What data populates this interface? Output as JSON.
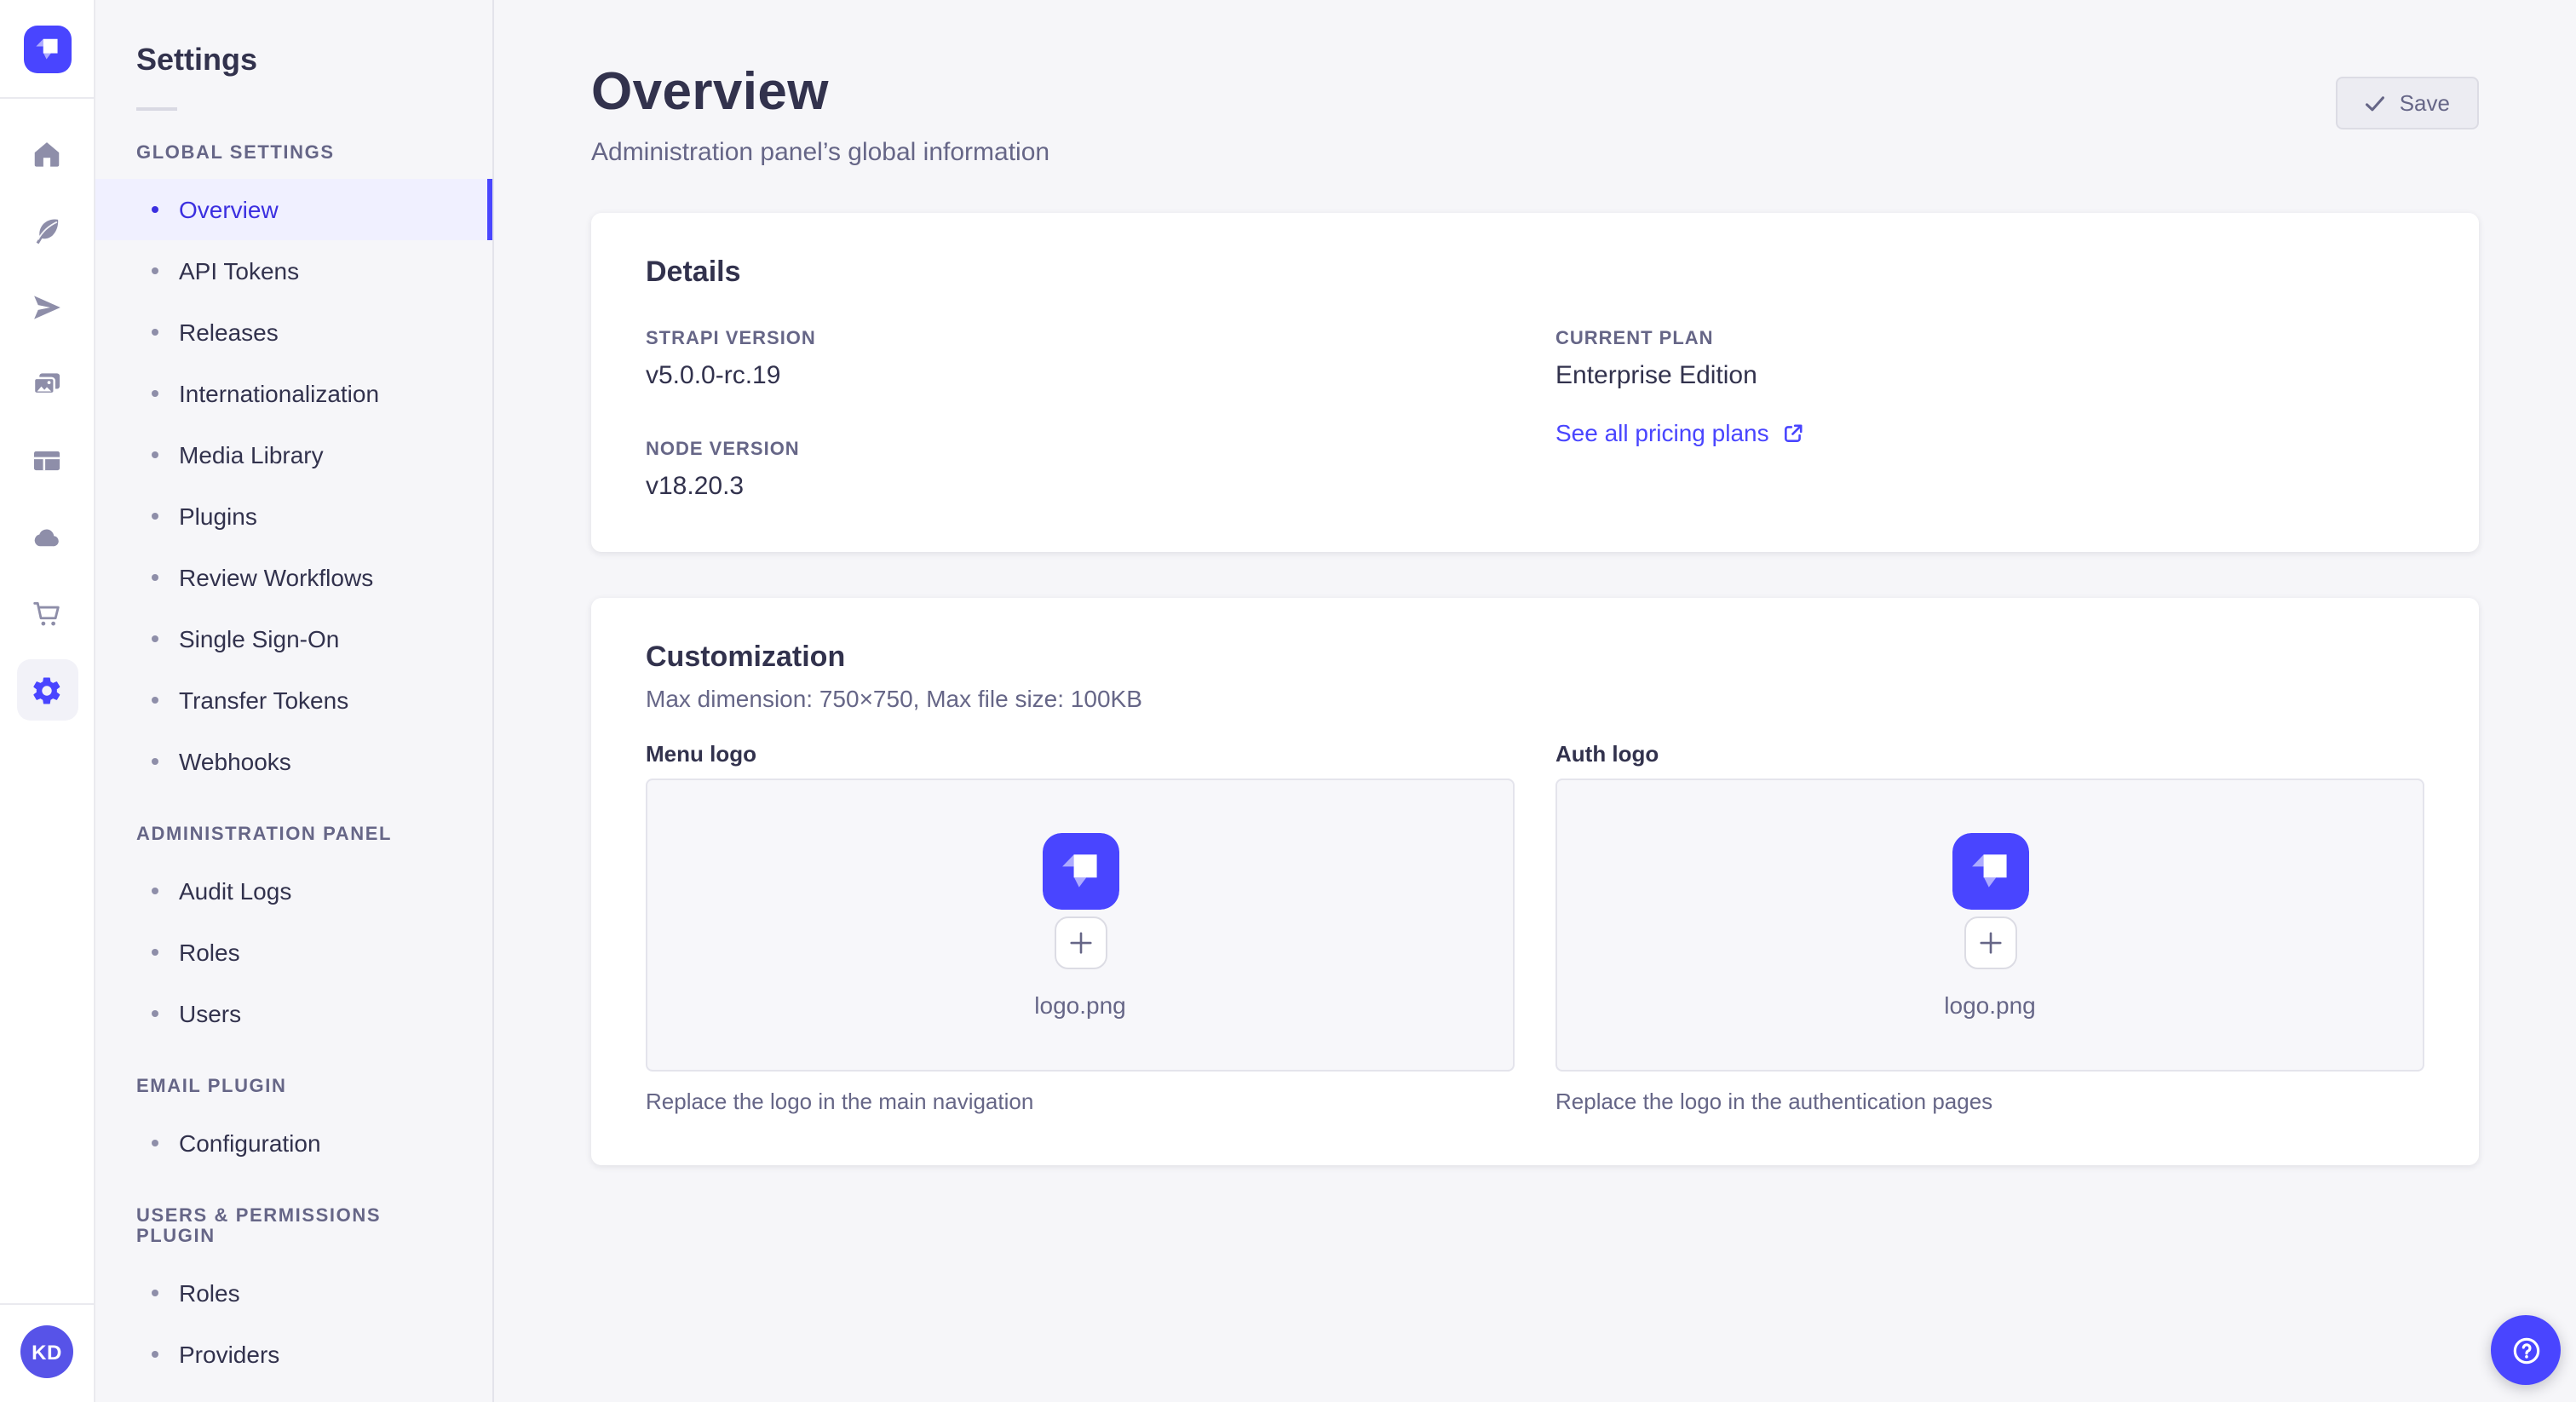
{
  "colors": {
    "accent": "#4945ff",
    "active_text": "#3b2fe0",
    "active_bg": "#f0f0ff",
    "text_dark": "#32324d",
    "text_muted": "#666687",
    "page_bg": "#f6f6f9"
  },
  "icon_rail": {
    "logo": "strapi-logo",
    "items": [
      {
        "icon": "home-icon"
      },
      {
        "icon": "feather-icon"
      },
      {
        "icon": "paper-plane-icon"
      },
      {
        "icon": "media-library-icon"
      },
      {
        "icon": "layout-icon"
      },
      {
        "icon": "cloud-icon"
      },
      {
        "icon": "cart-icon"
      },
      {
        "icon": "gear-icon",
        "active": true
      }
    ],
    "user": {
      "initials": "KD"
    }
  },
  "nav": {
    "title": "Settings",
    "sections": [
      {
        "label": "GLOBAL SETTINGS",
        "items": [
          {
            "label": "Overview",
            "active": true
          },
          {
            "label": "API Tokens"
          },
          {
            "label": "Releases"
          },
          {
            "label": "Internationalization"
          },
          {
            "label": "Media Library"
          },
          {
            "label": "Plugins"
          },
          {
            "label": "Review Workflows"
          },
          {
            "label": "Single Sign-On"
          },
          {
            "label": "Transfer Tokens"
          },
          {
            "label": "Webhooks"
          }
        ]
      },
      {
        "label": "ADMINISTRATION PANEL",
        "items": [
          {
            "label": "Audit Logs"
          },
          {
            "label": "Roles"
          },
          {
            "label": "Users"
          }
        ]
      },
      {
        "label": "EMAIL PLUGIN",
        "items": [
          {
            "label": "Configuration"
          }
        ]
      },
      {
        "label": "USERS & PERMISSIONS PLUGIN",
        "items": [
          {
            "label": "Roles"
          },
          {
            "label": "Providers"
          }
        ]
      }
    ]
  },
  "header": {
    "title": "Overview",
    "subtitle": "Administration panel’s global information",
    "save_label": "Save"
  },
  "details_card": {
    "title": "Details",
    "strapi_version": {
      "label": "STRAPI VERSION",
      "value": "v5.0.0-rc.19"
    },
    "current_plan": {
      "label": "CURRENT PLAN",
      "value": "Enterprise Edition"
    },
    "node_version": {
      "label": "NODE VERSION",
      "value": "v18.20.3"
    },
    "pricing_link": "See all pricing plans"
  },
  "customization_card": {
    "title": "Customization",
    "subtitle": "Max dimension: 750×750, Max file size: 100KB",
    "menu_logo": {
      "label": "Menu logo",
      "filename": "logo.png",
      "caption": "Replace the logo in the main navigation"
    },
    "auth_logo": {
      "label": "Auth logo",
      "filename": "logo.png",
      "caption": "Replace the logo in the authentication pages"
    }
  }
}
